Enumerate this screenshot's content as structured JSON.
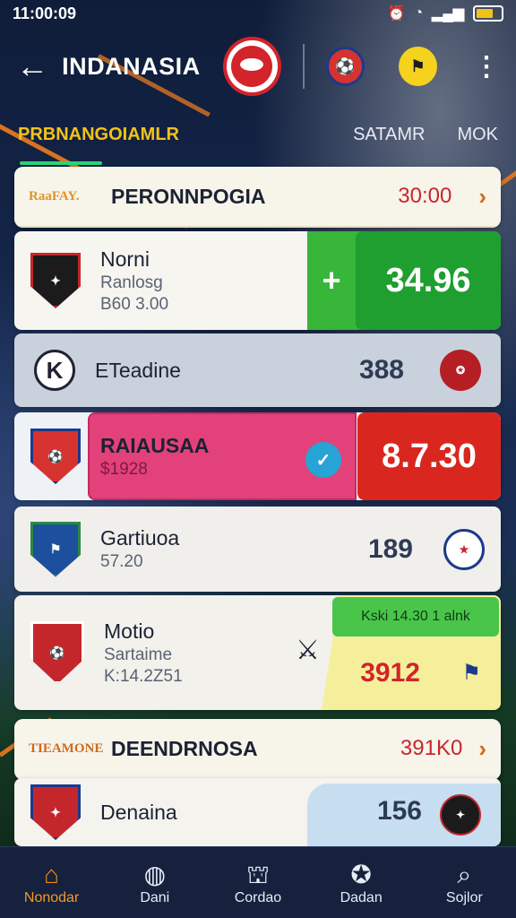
{
  "status": {
    "time": "11:00:09",
    "icons": [
      "alarm-icon",
      "wifi-icon",
      "signal-icon",
      "battery-icon"
    ]
  },
  "header": {
    "title": "INDANASIA",
    "back_icon": "arrow-left-icon",
    "more_icon": "more-vertical-icon"
  },
  "subtabs": {
    "active": "PRBNANGOIAMLR",
    "tab2": "SATAMR",
    "tab3": "MOK"
  },
  "section1": {
    "tag": "RaaFAY.",
    "title": "PERONNPOGIA",
    "time": "30:00",
    "chevron": "›"
  },
  "rows": [
    {
      "name": "Norni",
      "sub1": "Ranlosg",
      "sub2": "B60 3.00",
      "plus": "+",
      "odds": "34.96"
    },
    {
      "name": "ETeadine",
      "value": "388"
    },
    {
      "name": "RAIAUSAA",
      "sub1": "$1928",
      "odds": "8.7.30"
    },
    {
      "name": "Gartiuoa",
      "sub1": "57.20",
      "value": "189"
    },
    {
      "name": "Motio",
      "sub1": "Sartaime",
      "sub2": "K:14.2Z51",
      "pill": "Kski 14.30 1 alnk",
      "value": "3912"
    }
  ],
  "section2": {
    "tag": "TIEAMONE",
    "title": "DEENDRNOSA",
    "time": "391K0",
    "chevron": "›"
  },
  "row6": {
    "name": "Denaina",
    "value": "156"
  },
  "nav": [
    {
      "label": "Nonodar",
      "icon": "home-icon"
    },
    {
      "label": "Dani",
      "icon": "ball-icon"
    },
    {
      "label": "Cordao",
      "icon": "stadium-icon"
    },
    {
      "label": "Dadan",
      "icon": "whistle-icon"
    },
    {
      "label": "Sojlor",
      "icon": "search-icon"
    }
  ],
  "colors": {
    "accent": "#f2c21a",
    "green": "#37b63a",
    "red": "#d9271f",
    "pink": "#e2417a",
    "nav_bg": "#15213d"
  }
}
